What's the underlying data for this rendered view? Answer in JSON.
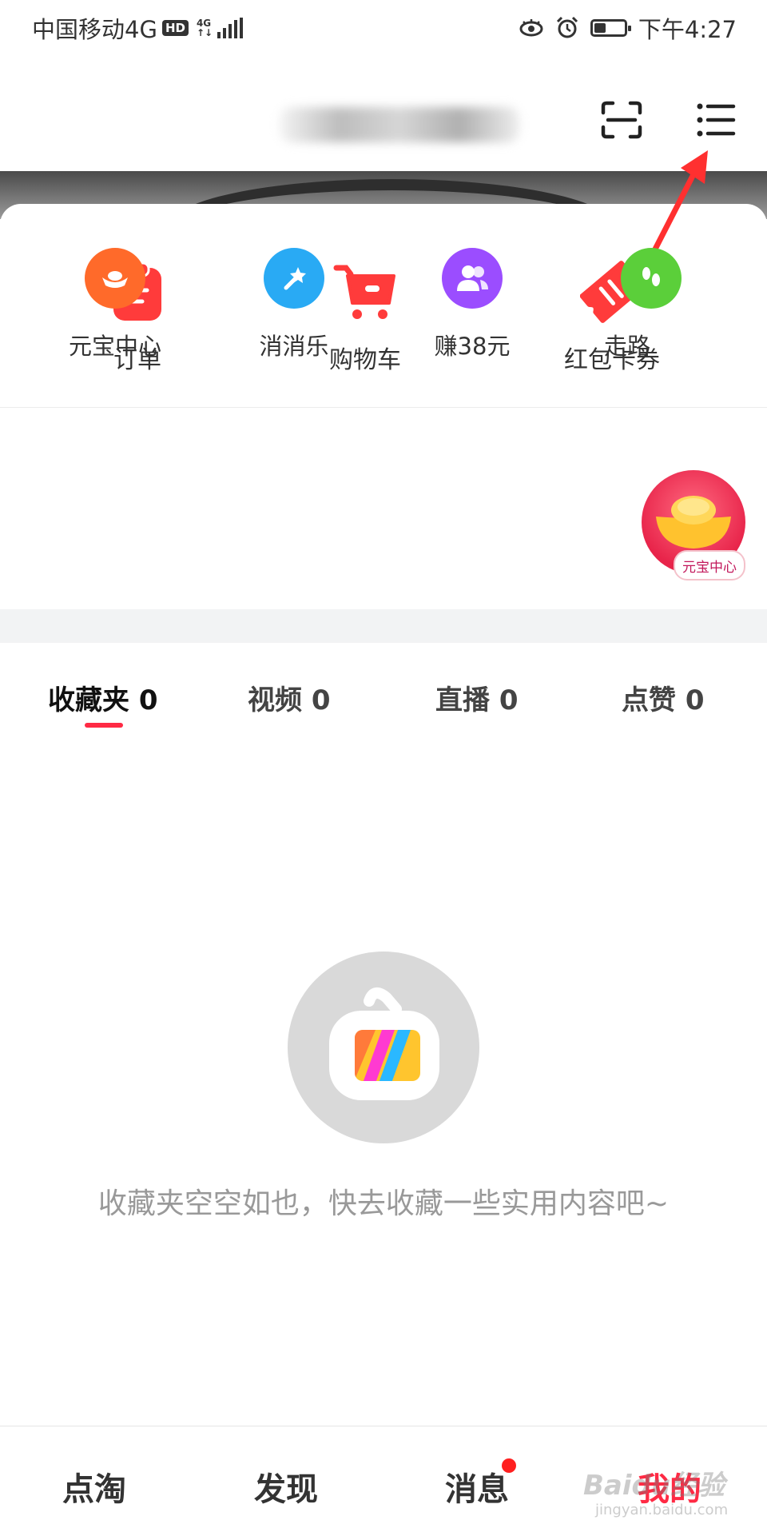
{
  "status_bar": {
    "carrier": "中国移动4G",
    "hd_badge": "HD",
    "network_top": "4G",
    "network_bottom": "↑↓",
    "time": "下午4:27",
    "battery_level": 0.4
  },
  "header": {
    "scan_icon": "scan-icon",
    "menu_icon": "menu-icon"
  },
  "quick_actions": [
    {
      "label": "订单",
      "icon": "order-clipboard-icon"
    },
    {
      "label": "购物车",
      "icon": "shopping-cart-icon"
    },
    {
      "label": "红包卡券",
      "icon": "coupon-ticket-icon"
    }
  ],
  "tools": [
    {
      "label": "元宝中心",
      "icon": "ingot-icon",
      "color": "#ff6a2a"
    },
    {
      "label": "消消乐",
      "icon": "magic-wand-icon",
      "color": "#29aaf4"
    },
    {
      "label": "赚38元",
      "icon": "users-icon",
      "color": "#9b4dff"
    },
    {
      "label": "走路",
      "icon": "footprint-icon",
      "color": "#5bcf3a"
    }
  ],
  "floating_badge": {
    "label": "元宝中心"
  },
  "tabs": [
    {
      "label": "收藏夹 0",
      "active": true
    },
    {
      "label": "视频 0",
      "active": false
    },
    {
      "label": "直播 0",
      "active": false
    },
    {
      "label": "点赞 0",
      "active": false
    }
  ],
  "empty_state": {
    "icon": "tv-empty-icon",
    "message": "收藏夹空空如也，快去收藏一些实用内容吧~"
  },
  "bottom_nav": [
    {
      "label": "点淘",
      "active": false
    },
    {
      "label": "发现",
      "active": false
    },
    {
      "label": "消息",
      "active": false,
      "badge": true
    },
    {
      "label": "我的",
      "active": true
    }
  ],
  "watermark": {
    "text": "Baidu经验",
    "sub": "jingyan.baidu.com"
  },
  "colors": {
    "accent": "#ff2a44",
    "empty_gray": "#d9d9d9"
  }
}
